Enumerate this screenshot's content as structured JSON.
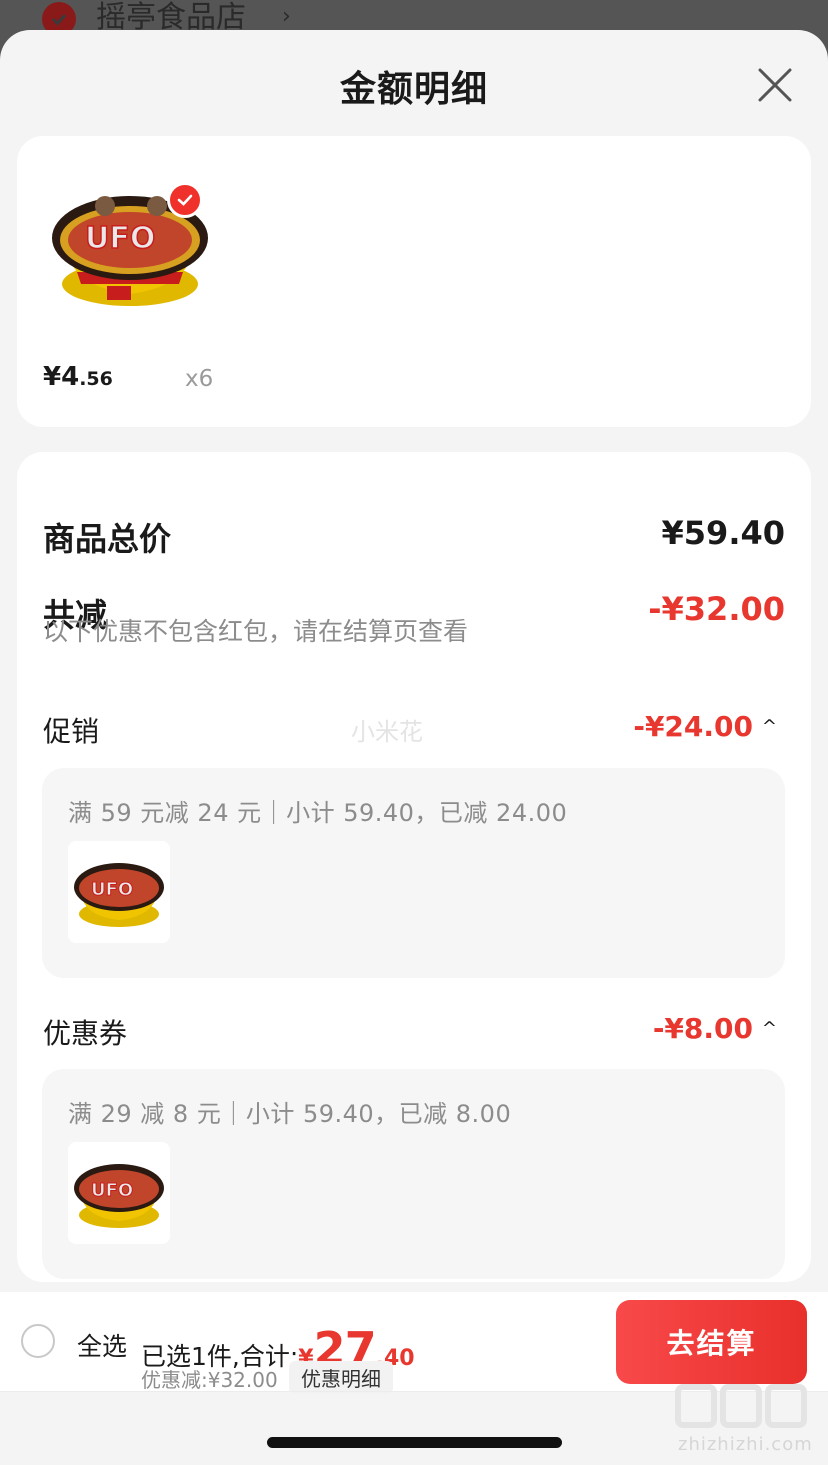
{
  "background": {
    "store_name": "摇亭食品店",
    "chevron": "›"
  },
  "sheet": {
    "title": "金额明细",
    "close_icon": "close-icon"
  },
  "product": {
    "price_symbol": "¥",
    "price_int": "4",
    "price_dec": ".56",
    "quantity": "x6",
    "selected": true
  },
  "breakdown": {
    "total_label": "商品总价",
    "total_value": "¥59.40",
    "reduction_label": "共减",
    "reduction_value": "-¥32.00",
    "note": "以下优惠不包含红包，请在结算页查看",
    "watermark": "小米花",
    "promotion": {
      "label": "促销",
      "value": "-¥24.00",
      "caret": "^",
      "rule": "满 59 元减 24 元｜小计 59.40，已减 24.00"
    },
    "coupon": {
      "label": "优惠券",
      "value": "-¥8.00",
      "caret": "^",
      "rule": "满 29 减 8 元｜小计 59.40，已减 8.00"
    }
  },
  "bottom_bar": {
    "select_all": "全选",
    "selected_count": "已选1件,合计:",
    "total_symbol": "¥",
    "total_int": "27",
    "total_dec": ".40",
    "discount": "优惠减:¥32.00",
    "detail_chip": "优惠明细",
    "checkout_button": "去结算"
  },
  "watermark_brand": {
    "text": "zhizhizhi.com"
  },
  "colors": {
    "accent_red": "#e8372f",
    "button_red": "#f0312b"
  }
}
